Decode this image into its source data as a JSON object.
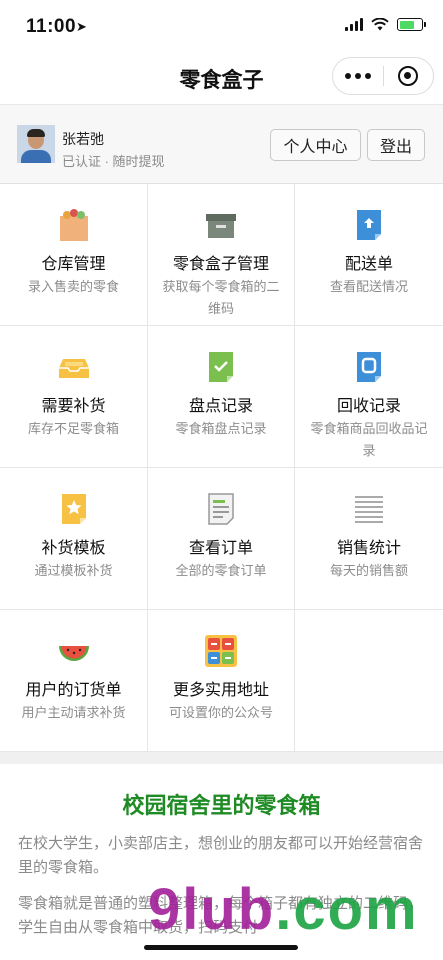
{
  "status_bar": {
    "time": "11:00"
  },
  "nav": {
    "title": "零食盒子"
  },
  "user": {
    "name": "张若弛",
    "subtitle": "已认证 · 随时提现",
    "center_button": "个人中心",
    "logout_button": "登出"
  },
  "grid": [
    {
      "label": "仓库管理",
      "desc": "录入售卖的零食",
      "icon": "warehouse-bag-icon"
    },
    {
      "label": "零食盒子管理",
      "desc": "获取每个零食箱的二维码",
      "icon": "archive-box-icon"
    },
    {
      "label": "配送单",
      "desc": "查看配送情况",
      "icon": "upload-doc-icon"
    },
    {
      "label": "需要补货",
      "desc": "库存不足零食箱",
      "icon": "inbox-tray-icon"
    },
    {
      "label": "盘点记录",
      "desc": "零食箱盘点记录",
      "icon": "check-doc-icon"
    },
    {
      "label": "回收记录",
      "desc": "零食箱商品回收品记录",
      "icon": "recycle-doc-icon"
    },
    {
      "label": "补货模板",
      "desc": "通过模板补货",
      "icon": "star-doc-icon"
    },
    {
      "label": "查看订单",
      "desc": "全部的零食订单",
      "icon": "order-list-icon"
    },
    {
      "label": "销售统计",
      "desc": "每天的销售额",
      "icon": "stats-lines-icon"
    },
    {
      "label": "用户的订货单",
      "desc": "用户主动请求补货",
      "icon": "watermelon-icon"
    },
    {
      "label": "更多实用地址",
      "desc": "可设置你的公众号",
      "icon": "apps-grid-icon"
    }
  ],
  "article": {
    "heading": "校园宿舍里的零食箱",
    "p1": "在校大学生，小卖部店主，想创业的朋友都可以开始经营宿舍里的零食箱。",
    "p2": "零食箱就是普通的塑料整理箱，每个箱子都有独立的二维码，学生自由从零食箱中取货，扫码支付",
    "p3": ""
  },
  "watermark": {
    "part1": "9lub",
    "part2": ".com"
  },
  "colors": {
    "accent": "#1f8b24",
    "watermark_purple": "#a3209a",
    "watermark_green": "#1ca243"
  }
}
